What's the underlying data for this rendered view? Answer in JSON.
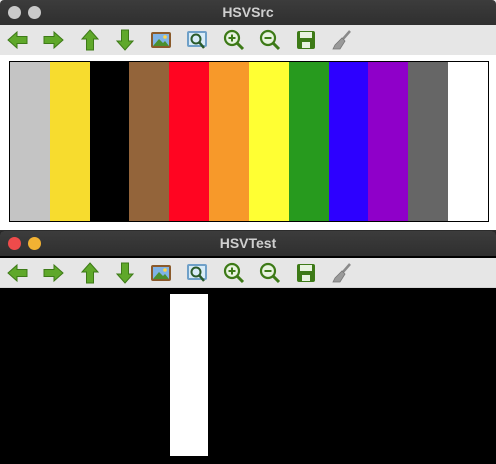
{
  "windows": [
    {
      "title": "HSVSrc"
    },
    {
      "title": "HSVTest"
    }
  ],
  "toolbar_icons": [
    "arrow-left-icon",
    "arrow-right-icon",
    "arrow-up-icon",
    "arrow-down-icon",
    "picture-icon",
    "zoom-fit-icon",
    "zoom-in-icon",
    "zoom-out-icon",
    "save-icon",
    "clear-brush-icon"
  ],
  "src_image": {
    "colors": [
      "#c4c4c4",
      "#f7dc2e",
      "#000000",
      "#93643a",
      "#ff0521",
      "#f7992a",
      "#ffff33",
      "#279a1e",
      "#2d00ff",
      "#8f00c9",
      "#666666",
      "#ffffff"
    ]
  },
  "result_image": {
    "background": "#000000",
    "white_band_index": 5
  }
}
